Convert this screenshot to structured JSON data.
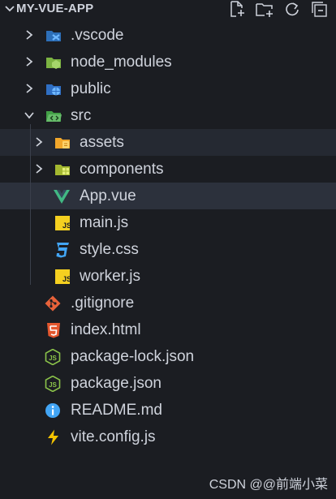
{
  "explorer": {
    "title": "MY-VUE-APP",
    "actions": [
      {
        "name": "new-file",
        "icon": "new-file-icon"
      },
      {
        "name": "new-folder",
        "icon": "new-folder-icon"
      },
      {
        "name": "refresh",
        "icon": "refresh-icon"
      },
      {
        "name": "collapse-all",
        "icon": "collapse-all-icon"
      }
    ]
  },
  "tree": [
    {
      "label": ".vscode",
      "type": "folder",
      "expanded": false,
      "icon": "vscode-folder-icon",
      "icon_color": "#3b8fe0"
    },
    {
      "label": "node_modules",
      "type": "folder",
      "expanded": false,
      "icon": "node-modules-folder-icon",
      "icon_color": "#8bc34a"
    },
    {
      "label": "public",
      "type": "folder",
      "expanded": false,
      "icon": "public-folder-icon",
      "icon_color": "#2f7ad8"
    },
    {
      "label": "src",
      "type": "folder",
      "expanded": true,
      "icon": "src-folder-icon",
      "icon_color": "#4caf50"
    },
    {
      "label": "assets",
      "type": "folder",
      "expanded": false,
      "icon": "assets-folder-icon",
      "icon_color": "#f6b93b"
    },
    {
      "label": "components",
      "type": "folder",
      "expanded": false,
      "icon": "components-folder-icon",
      "icon_color": "#b5cc3a"
    },
    {
      "label": "App.vue",
      "type": "file",
      "icon": "vue-icon",
      "icon_color": "#41b883",
      "selected": true
    },
    {
      "label": "main.js",
      "type": "file",
      "icon": "js-icon",
      "icon_color": "#f5d020"
    },
    {
      "label": "style.css",
      "type": "file",
      "icon": "css-icon",
      "icon_color": "#42a5f5"
    },
    {
      "label": "worker.js",
      "type": "file",
      "icon": "js-icon",
      "icon_color": "#f5d020"
    },
    {
      "label": ".gitignore",
      "type": "file",
      "icon": "git-icon",
      "icon_color": "#e8623a"
    },
    {
      "label": "index.html",
      "type": "file",
      "icon": "html-icon",
      "icon_color": "#e4572e"
    },
    {
      "label": "package-lock.json",
      "type": "file",
      "icon": "nodejs-icon",
      "icon_color": "#8bc34a"
    },
    {
      "label": "package.json",
      "type": "file",
      "icon": "nodejs-icon",
      "icon_color": "#8bc34a"
    },
    {
      "label": "README.md",
      "type": "file",
      "icon": "info-icon",
      "icon_color": "#42a5f5"
    },
    {
      "label": "vite.config.js",
      "type": "file",
      "icon": "vite-icon",
      "icon_color": "#f5c400"
    }
  ],
  "watermark": "CSDN @@前端小菜"
}
